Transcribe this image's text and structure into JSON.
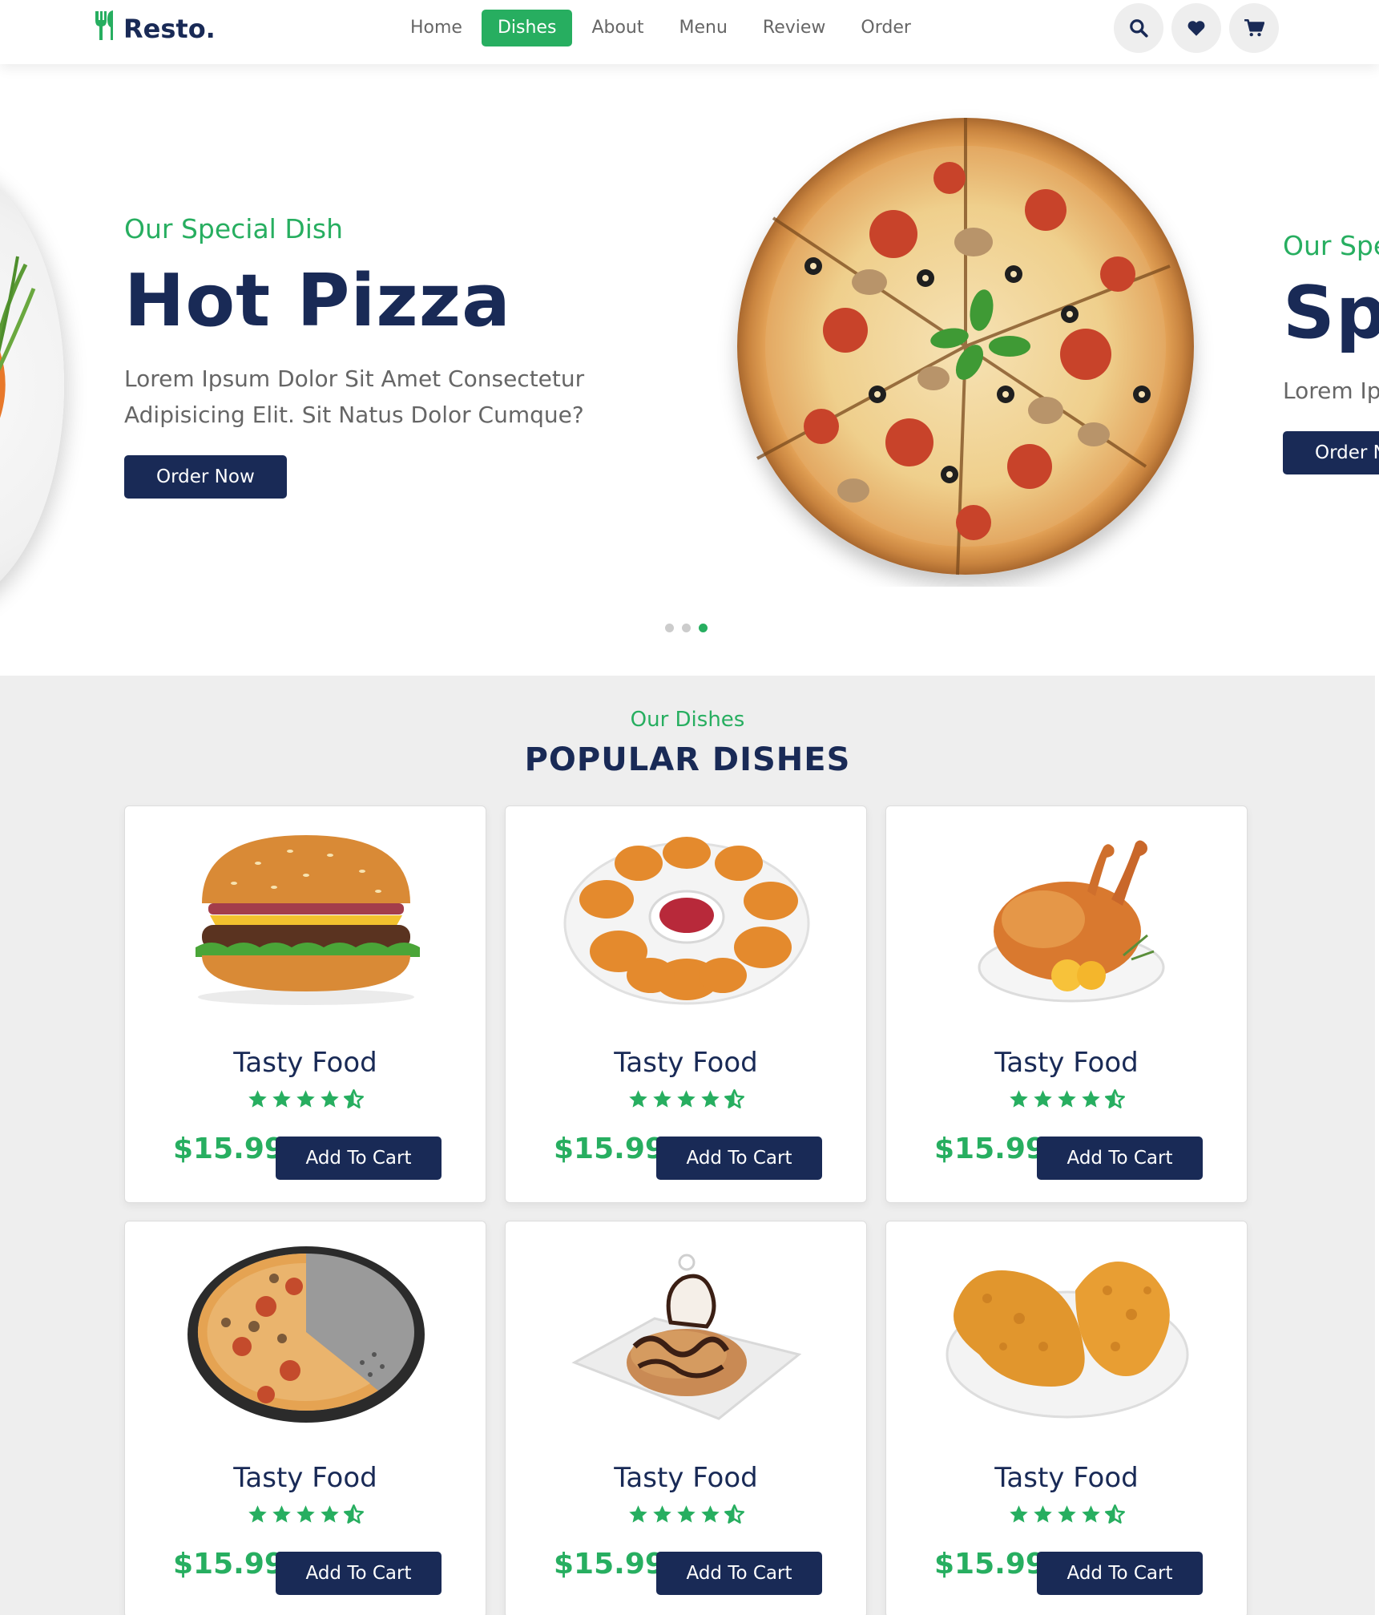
{
  "header": {
    "logo": "Resto.",
    "nav": [
      "Home",
      "Dishes",
      "About",
      "Menu",
      "Review",
      "Order"
    ],
    "active_nav": "Dishes",
    "icons": [
      "search-icon",
      "heart-icon",
      "cart-icon"
    ]
  },
  "hero": {
    "current_slide": {
      "subtitle": "Our Special Dish",
      "title": "Hot Pizza",
      "description": "Lorem Ipsum Dolor Sit Amet Consectetur Adipisicing Elit. Sit Natus Dolor Cumque?",
      "button": "Order Now"
    },
    "next_slide_partial": {
      "subtitle": "Our Spe",
      "title": "Sp",
      "description": "Lorem Ip Adipisicin",
      "button": "Order N"
    },
    "slide_count": 3,
    "active_slide": 3
  },
  "dishes": {
    "subtitle": "Our Dishes",
    "title": "POPULAR DISHES",
    "items": [
      {
        "name": "Tasty Food",
        "price": "$15.99",
        "button": "Add To Cart",
        "image": "burger",
        "rating": 4.5
      },
      {
        "name": "Tasty Food",
        "price": "$15.99",
        "button": "Add To Cart",
        "image": "chicken-nuggets",
        "rating": 4.5
      },
      {
        "name": "Tasty Food",
        "price": "$15.99",
        "button": "Add To Cart",
        "image": "roast-chicken",
        "rating": 4.5
      },
      {
        "name": "Tasty Food",
        "price": "$15.99",
        "button": "Add To Cart",
        "image": "pizza",
        "rating": 4.5
      },
      {
        "name": "Tasty Food",
        "price": "$15.99",
        "button": "Add To Cart",
        "image": "chocolate-dessert",
        "rating": 4.5
      },
      {
        "name": "Tasty Food",
        "price": "$15.99",
        "button": "Add To Cart",
        "image": "fried-chicken",
        "rating": 4.5
      }
    ]
  },
  "colors": {
    "green": "#27ae60",
    "navy": "#192a56",
    "gray_text": "#666666",
    "section_bg": "#eeeeee"
  }
}
